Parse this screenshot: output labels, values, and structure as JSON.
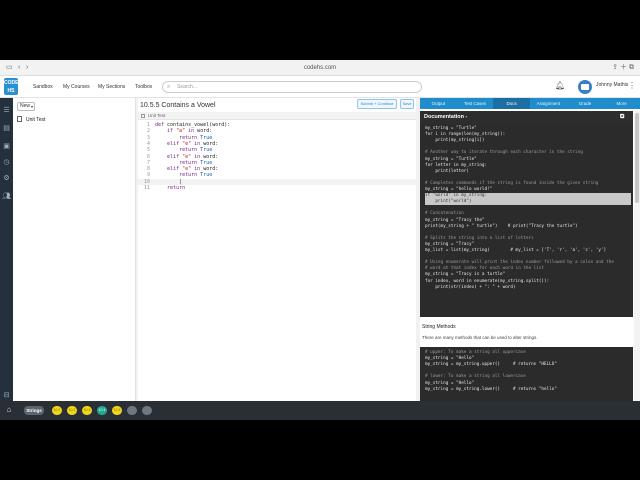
{
  "browser": {
    "url": "codehs.com"
  },
  "header": {
    "logo_text": "CODE HS",
    "nav": [
      "Sandbox",
      "My Courses",
      "My Sections",
      "Toolbox"
    ],
    "search_placeholder": "Search...",
    "user_name": "Johnny Mathis",
    "user_sub": ""
  },
  "files": {
    "new_label": "New",
    "items": [
      {
        "name": "Unit Test"
      }
    ]
  },
  "editor": {
    "title": "10.5.5 Contains a Vowel",
    "submit_label": "Submit + Continue",
    "save_label": "Save",
    "file_tab": "Unit Test",
    "lines": [
      "def contains_vowel(word):",
      "    if \"a\" in word:",
      "        return True",
      "    elif \"e\" in word:",
      "        return True",
      "    elif \"e\" in word:",
      "        return True",
      "    elif \"e\" in word:",
      "        return True",
      "        |",
      "    return"
    ],
    "active_line": 10
  },
  "right_panel": {
    "tabs": [
      "Output",
      "Test Cases",
      "Docs",
      "Assignment",
      "Grade",
      "More"
    ],
    "active_tab": "Docs",
    "doc_title": "Documentation -",
    "code_block_1": [
      {
        "t": "my_string = \"Turtle\"",
        "k": "code"
      },
      {
        "t": "for i in range(len(my_string)):",
        "k": "code"
      },
      {
        "t": "    print(my_string[i])",
        "k": "code"
      },
      {
        "t": "",
        "k": "code"
      },
      {
        "t": "# Another way to iterate through each character in the string",
        "k": "cmt"
      },
      {
        "t": "my_string = \"Turtle\"",
        "k": "code"
      },
      {
        "t": "for letter in my_string:",
        "k": "code"
      },
      {
        "t": "    print(letter)",
        "k": "code"
      },
      {
        "t": "",
        "k": "code"
      },
      {
        "t": "# Completes commands if the string is found inside the given string",
        "k": "cmt"
      },
      {
        "t": "my_string = \"hello world!\"",
        "k": "code"
      },
      {
        "t": "if \"world\" in my_string:",
        "k": "hl"
      },
      {
        "t": "    print(\"world\")",
        "k": "hl"
      },
      {
        "t": "",
        "k": "code"
      },
      {
        "t": "# Concatenation",
        "k": "cmt"
      },
      {
        "t": "my_string = \"Tracy the\"",
        "k": "code"
      },
      {
        "t": "print(my_string + \" turtle\")    # print(\"Tracy the turtle\")",
        "k": "code"
      },
      {
        "t": "",
        "k": "code"
      },
      {
        "t": "# Splits the string into a list of letters",
        "k": "cmt"
      },
      {
        "t": "my_string = \"Tracy\"",
        "k": "code"
      },
      {
        "t": "my_list = list(my_string)        # my_list = ['T', 'r', 'a', 'c', 'y']",
        "k": "code"
      },
      {
        "t": "",
        "k": "code"
      },
      {
        "t": "# Using enumerate will print the index number followed by a colon and the",
        "k": "cmt"
      },
      {
        "t": "# word at that index for each word in the list",
        "k": "cmt"
      },
      {
        "t": "my_string = \"Tracy is a turtle\"",
        "k": "code"
      },
      {
        "t": "for index, word in enumerate(my_string.split()):",
        "k": "code"
      },
      {
        "t": "    print(str(index) + \": \" + word)",
        "k": "code"
      }
    ],
    "methods_title": "String Methods",
    "methods_desc": "There are many methods that can be used to alter strings.",
    "code_block_2": [
      {
        "t": "# upper: To make a string all uppercase",
        "k": "cmt"
      },
      {
        "t": "my_string = \"Hello\"",
        "k": "code"
      },
      {
        "t": "my_string = my_string.upper()     # returns \"HELLO\"",
        "k": "code"
      },
      {
        "t": "",
        "k": "code"
      },
      {
        "t": "# lower: To make a string all lowercase",
        "k": "cmt"
      },
      {
        "t": "my_string = \"Hello\"",
        "k": "code"
      },
      {
        "t": "my_string = my_string.lower()     # returns \"hello\"",
        "k": "code"
      }
    ]
  },
  "bottom_bar": {
    "module": "Strings",
    "steps": [
      {
        "label": "10.1",
        "state": "done"
      },
      {
        "label": "10.2",
        "state": "done"
      },
      {
        "label": "10.3",
        "state": "done"
      },
      {
        "label": "10.4",
        "state": "current"
      },
      {
        "label": "10.5",
        "state": "done"
      },
      {
        "label": "",
        "state": "todo"
      },
      {
        "label": "",
        "state": "todo"
      }
    ]
  },
  "colors": {
    "tab_bar": "#1f8ccc",
    "rail": "#24313c",
    "done_step": "#f0d61e",
    "current_step": "#21a98f"
  }
}
